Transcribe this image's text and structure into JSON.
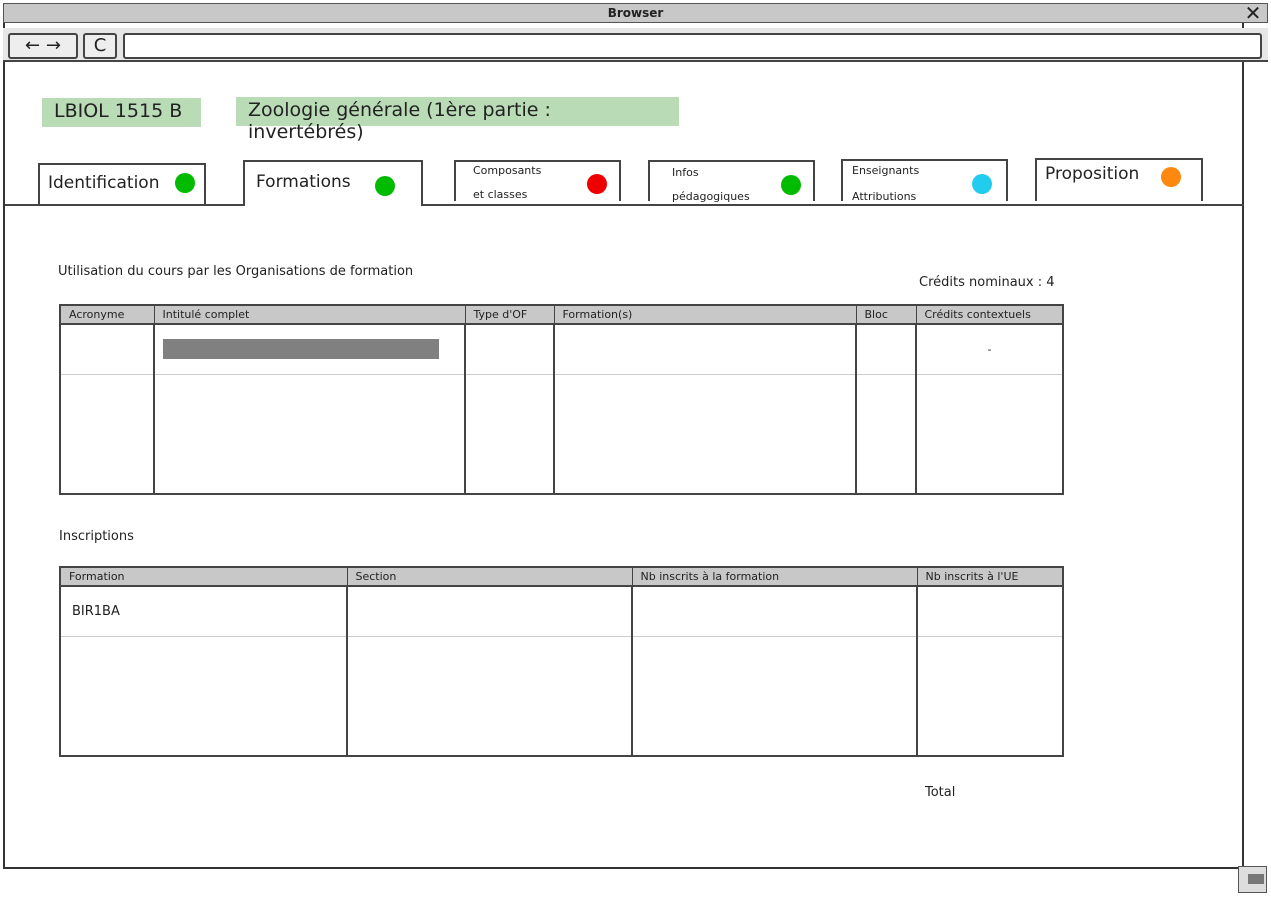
{
  "browser": {
    "title": "Browser",
    "back_forward_label": "← →",
    "reload_label": "C",
    "address_value": ""
  },
  "course": {
    "code": "LBIOL 1515 B",
    "title": "Zoologie générale (1ère partie : invertébrés)"
  },
  "tabs": [
    {
      "label": "Identification",
      "status_color": "#00bb00"
    },
    {
      "label": "Formations",
      "status_color": "#00bb00"
    },
    {
      "label_line1": "Composants",
      "label_line2": "et classes",
      "status_color": "#ee0000"
    },
    {
      "label_line1": "Infos",
      "label_line2": "pédagogiques",
      "status_color": "#00bb00"
    },
    {
      "label_line1": "Enseignants",
      "label_line2": "Attributions",
      "status_color": "#22ccee"
    },
    {
      "label": "Proposition",
      "status_color": "#ff8811"
    }
  ],
  "usage": {
    "heading": "Utilisation du cours par les Organisations de formation",
    "credits_label": "Crédits nominaux : 4",
    "columns": [
      "Acronyme",
      "Intitulé complet",
      "Type d'OF",
      "Formation(s)",
      "Bloc",
      "Crédits contextuels"
    ],
    "rows": [
      {
        "acronyme": "",
        "intitule": "",
        "type": "",
        "formations": "",
        "bloc": "",
        "credits": "-"
      }
    ]
  },
  "inscriptions": {
    "heading": "Inscriptions",
    "columns": [
      "Formation",
      "Section",
      "Nb inscrits à la formation",
      "Nb inscrits à l'UE"
    ],
    "rows": [
      {
        "formation": "BIR1BA",
        "section": "",
        "nb_formation": "",
        "nb_ue": ""
      }
    ],
    "total_label": "Total"
  }
}
